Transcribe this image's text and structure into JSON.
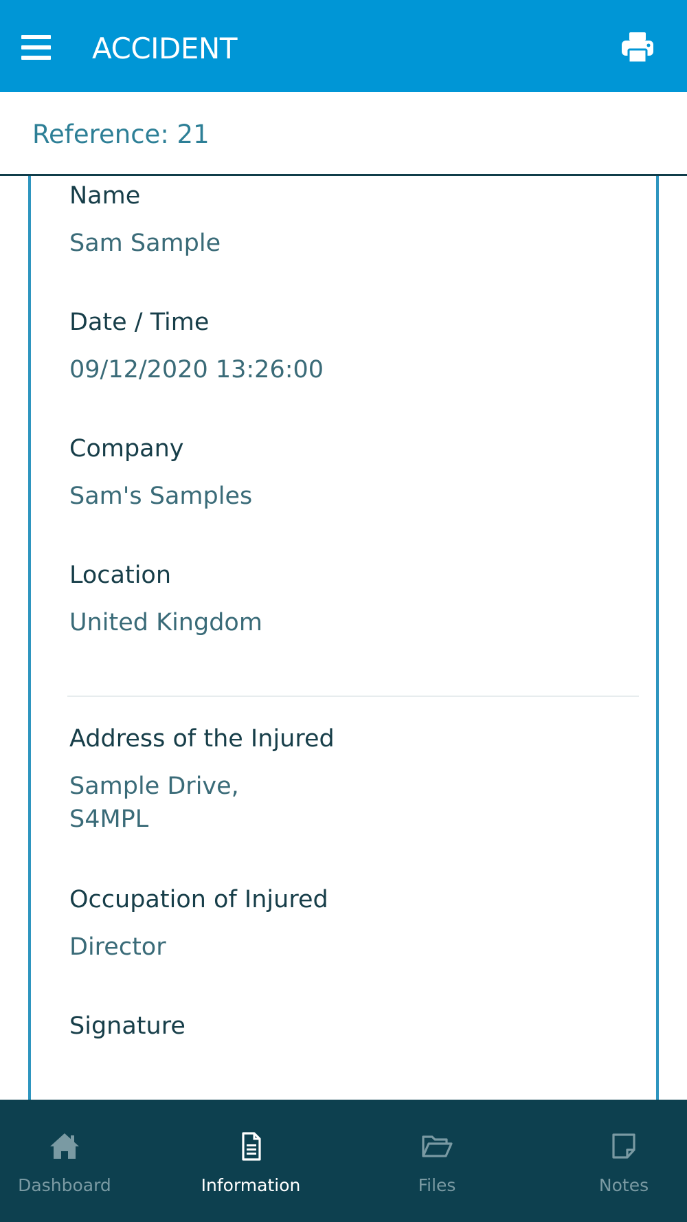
{
  "header": {
    "title": "ACCIDENT",
    "menu_icon": "hamburger-menu-icon",
    "print_icon": "printer-icon",
    "bar_color": "#0096d6"
  },
  "reference": {
    "text": "Reference: 21"
  },
  "fields": [
    {
      "label": "Name",
      "value": "Sam Sample"
    },
    {
      "label": "Date / Time",
      "value": "09/12/2020 13:26:00"
    },
    {
      "label": "Company",
      "value": "Sam's Samples"
    },
    {
      "label": "Location",
      "value": "United Kingdom"
    },
    {
      "label": "Address of the Injured",
      "value": "Sample Drive,\nS4MPL"
    },
    {
      "label": "Occupation of Injured",
      "value": "Director"
    },
    {
      "label": "Signature",
      "value": ""
    }
  ],
  "bottom_nav": {
    "background": "#0d404f",
    "items": [
      {
        "label": "Dashboard",
        "icon": "home-icon",
        "active": false
      },
      {
        "label": "Information",
        "icon": "document-icon",
        "active": true
      },
      {
        "label": "Files",
        "icon": "folder-open-icon",
        "active": false
      },
      {
        "label": "Notes",
        "icon": "note-icon",
        "active": false
      }
    ]
  }
}
